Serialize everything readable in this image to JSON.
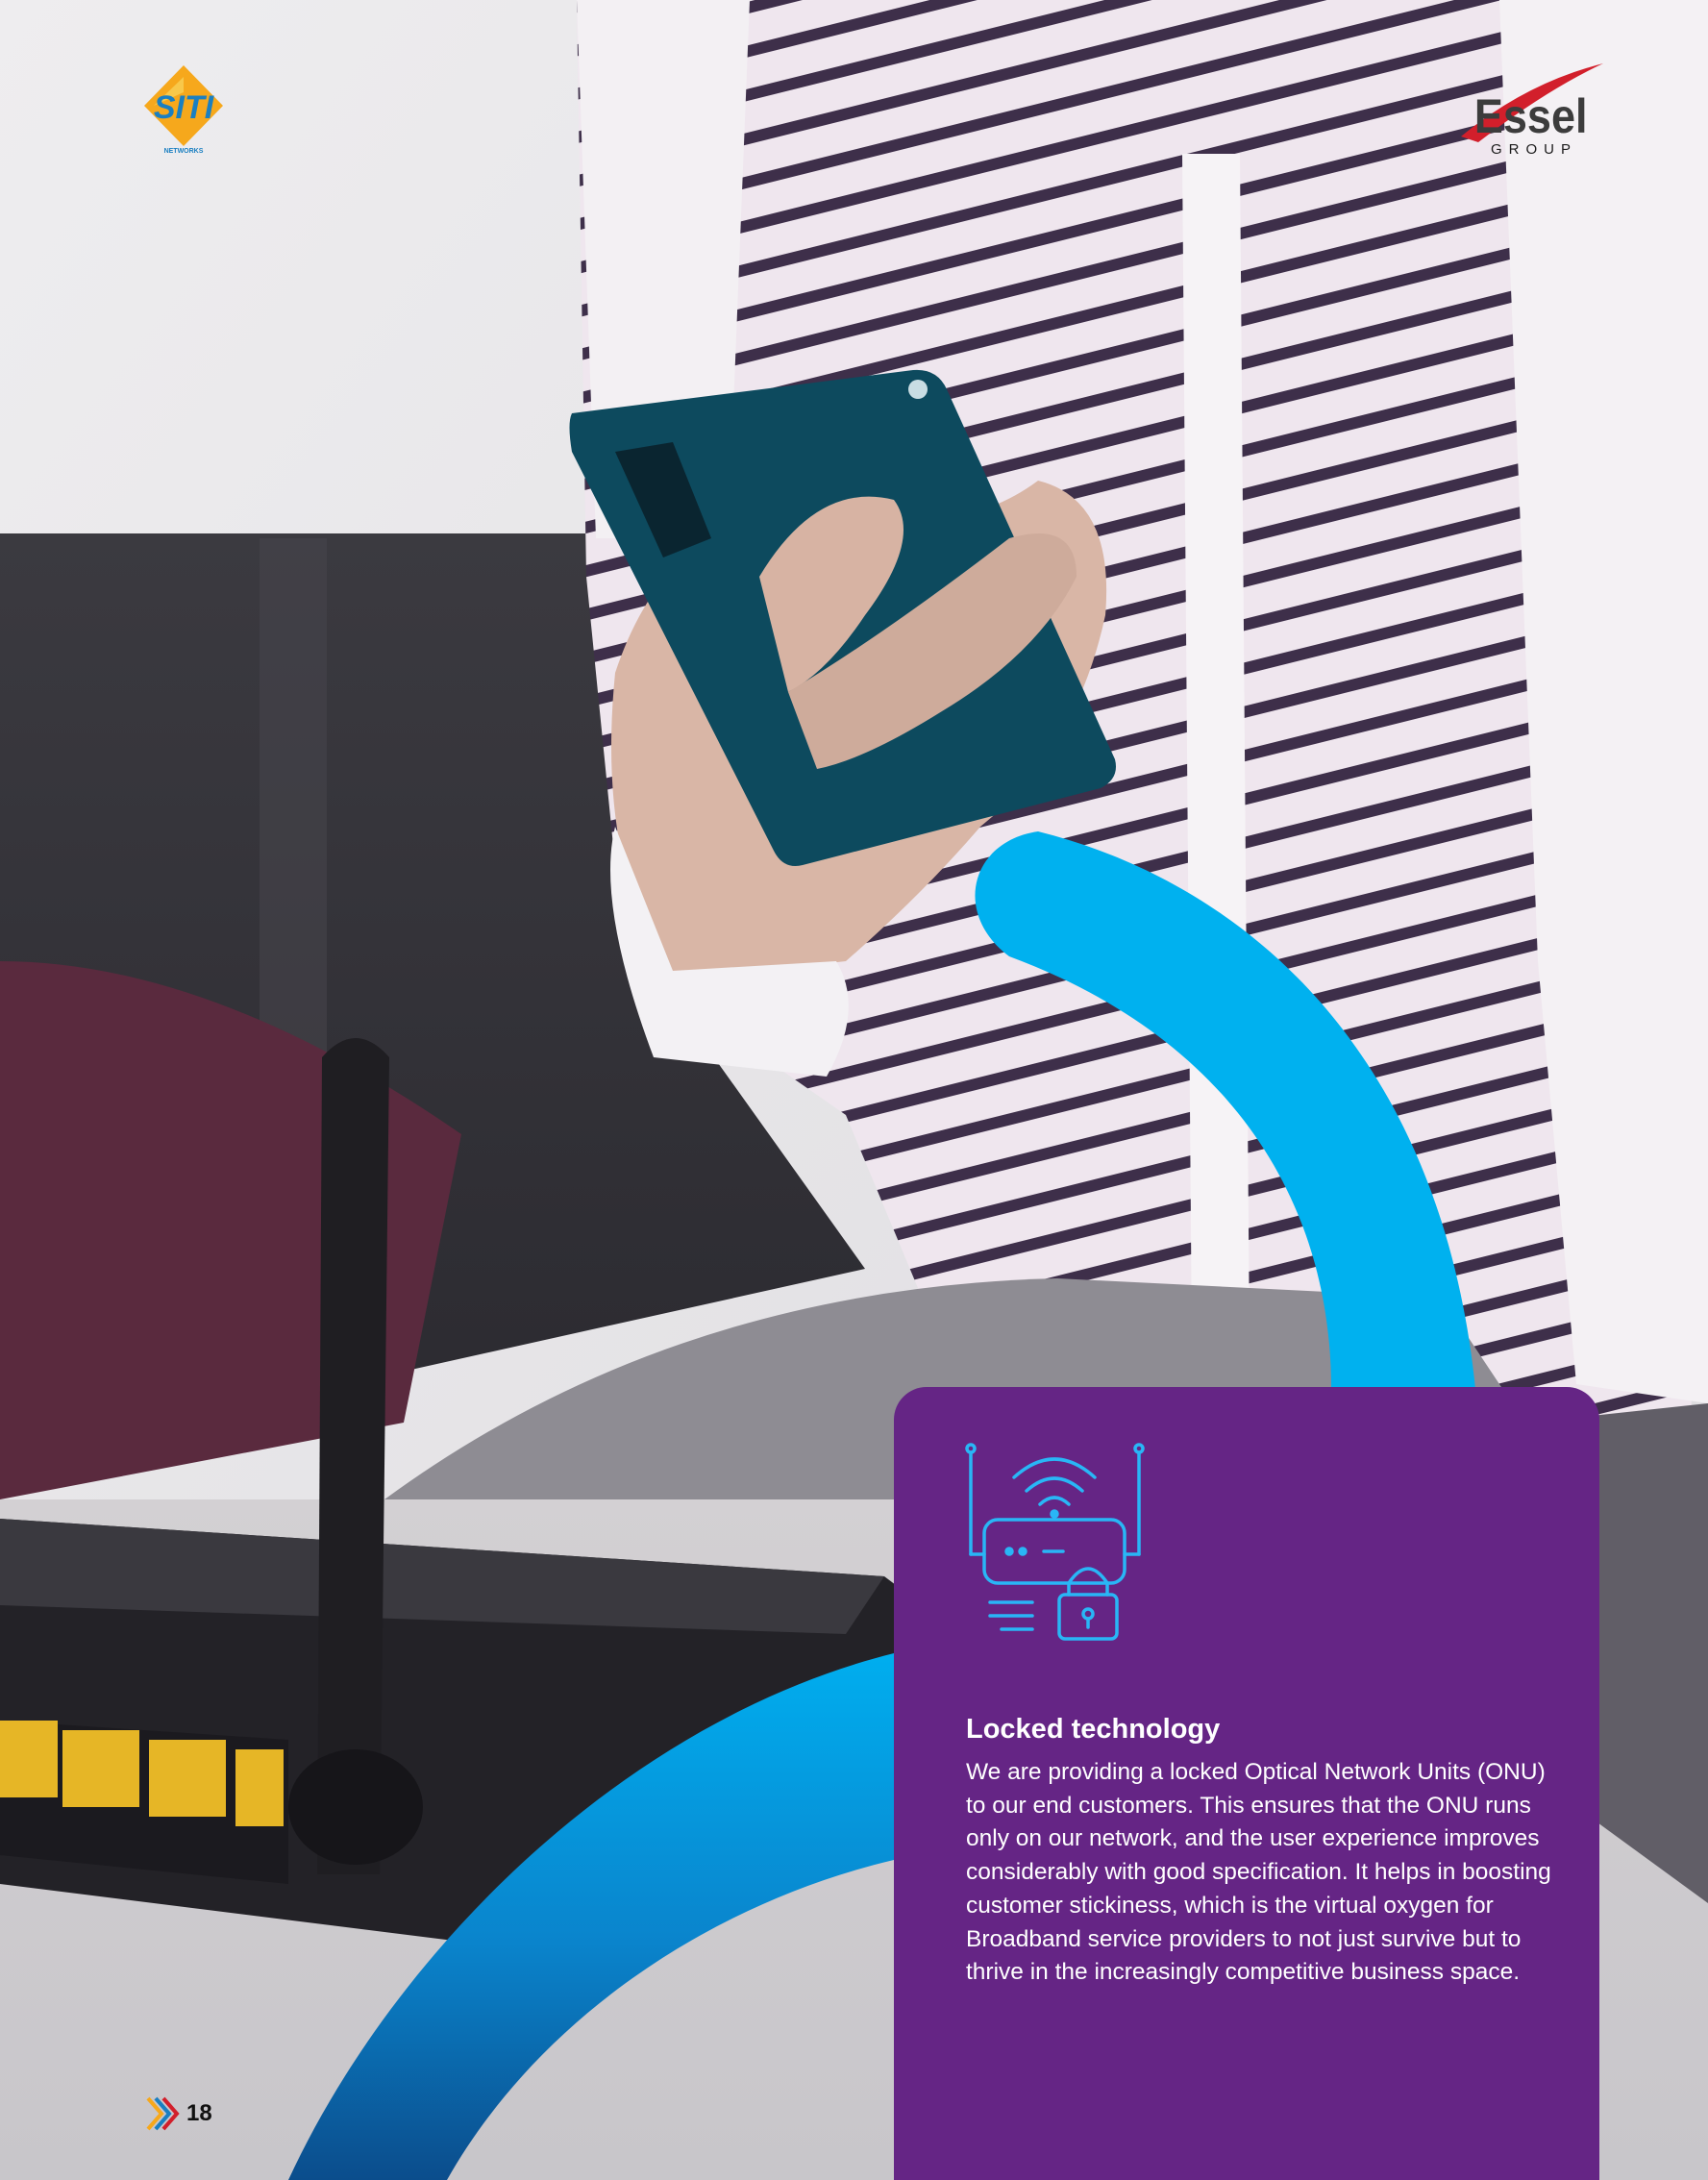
{
  "colors": {
    "card": "#652585",
    "arc": "#00aeef",
    "arc_dark": "#0a4f8f",
    "icon_stroke": "#29b6f6",
    "text_on_card": "#ffffff"
  },
  "header": {
    "left_logo_icon": "siti-networks-logo-icon",
    "left_logo_text": "SITI",
    "left_logo_subtext": "NETWORKS",
    "right_logo_icon": "essel-group-logo-icon",
    "right_logo_text": "Essel",
    "right_logo_subtext": "GROUP"
  },
  "card": {
    "icon": "router-lock-icon",
    "title": "Locked technology",
    "body": "We are providing a locked Optical Network Units (ONU) to our end customers. This ensures that the ONU runs only on our network, and the user experience improves considerably with good specification. It helps in boosting customer stickiness, which is the virtual oxygen for Broadband service providers to not just survive but to thrive in the increasingly competitive business space."
  },
  "footer": {
    "arrows_icon": "chevron-arrows-icon",
    "page_number": "18"
  }
}
